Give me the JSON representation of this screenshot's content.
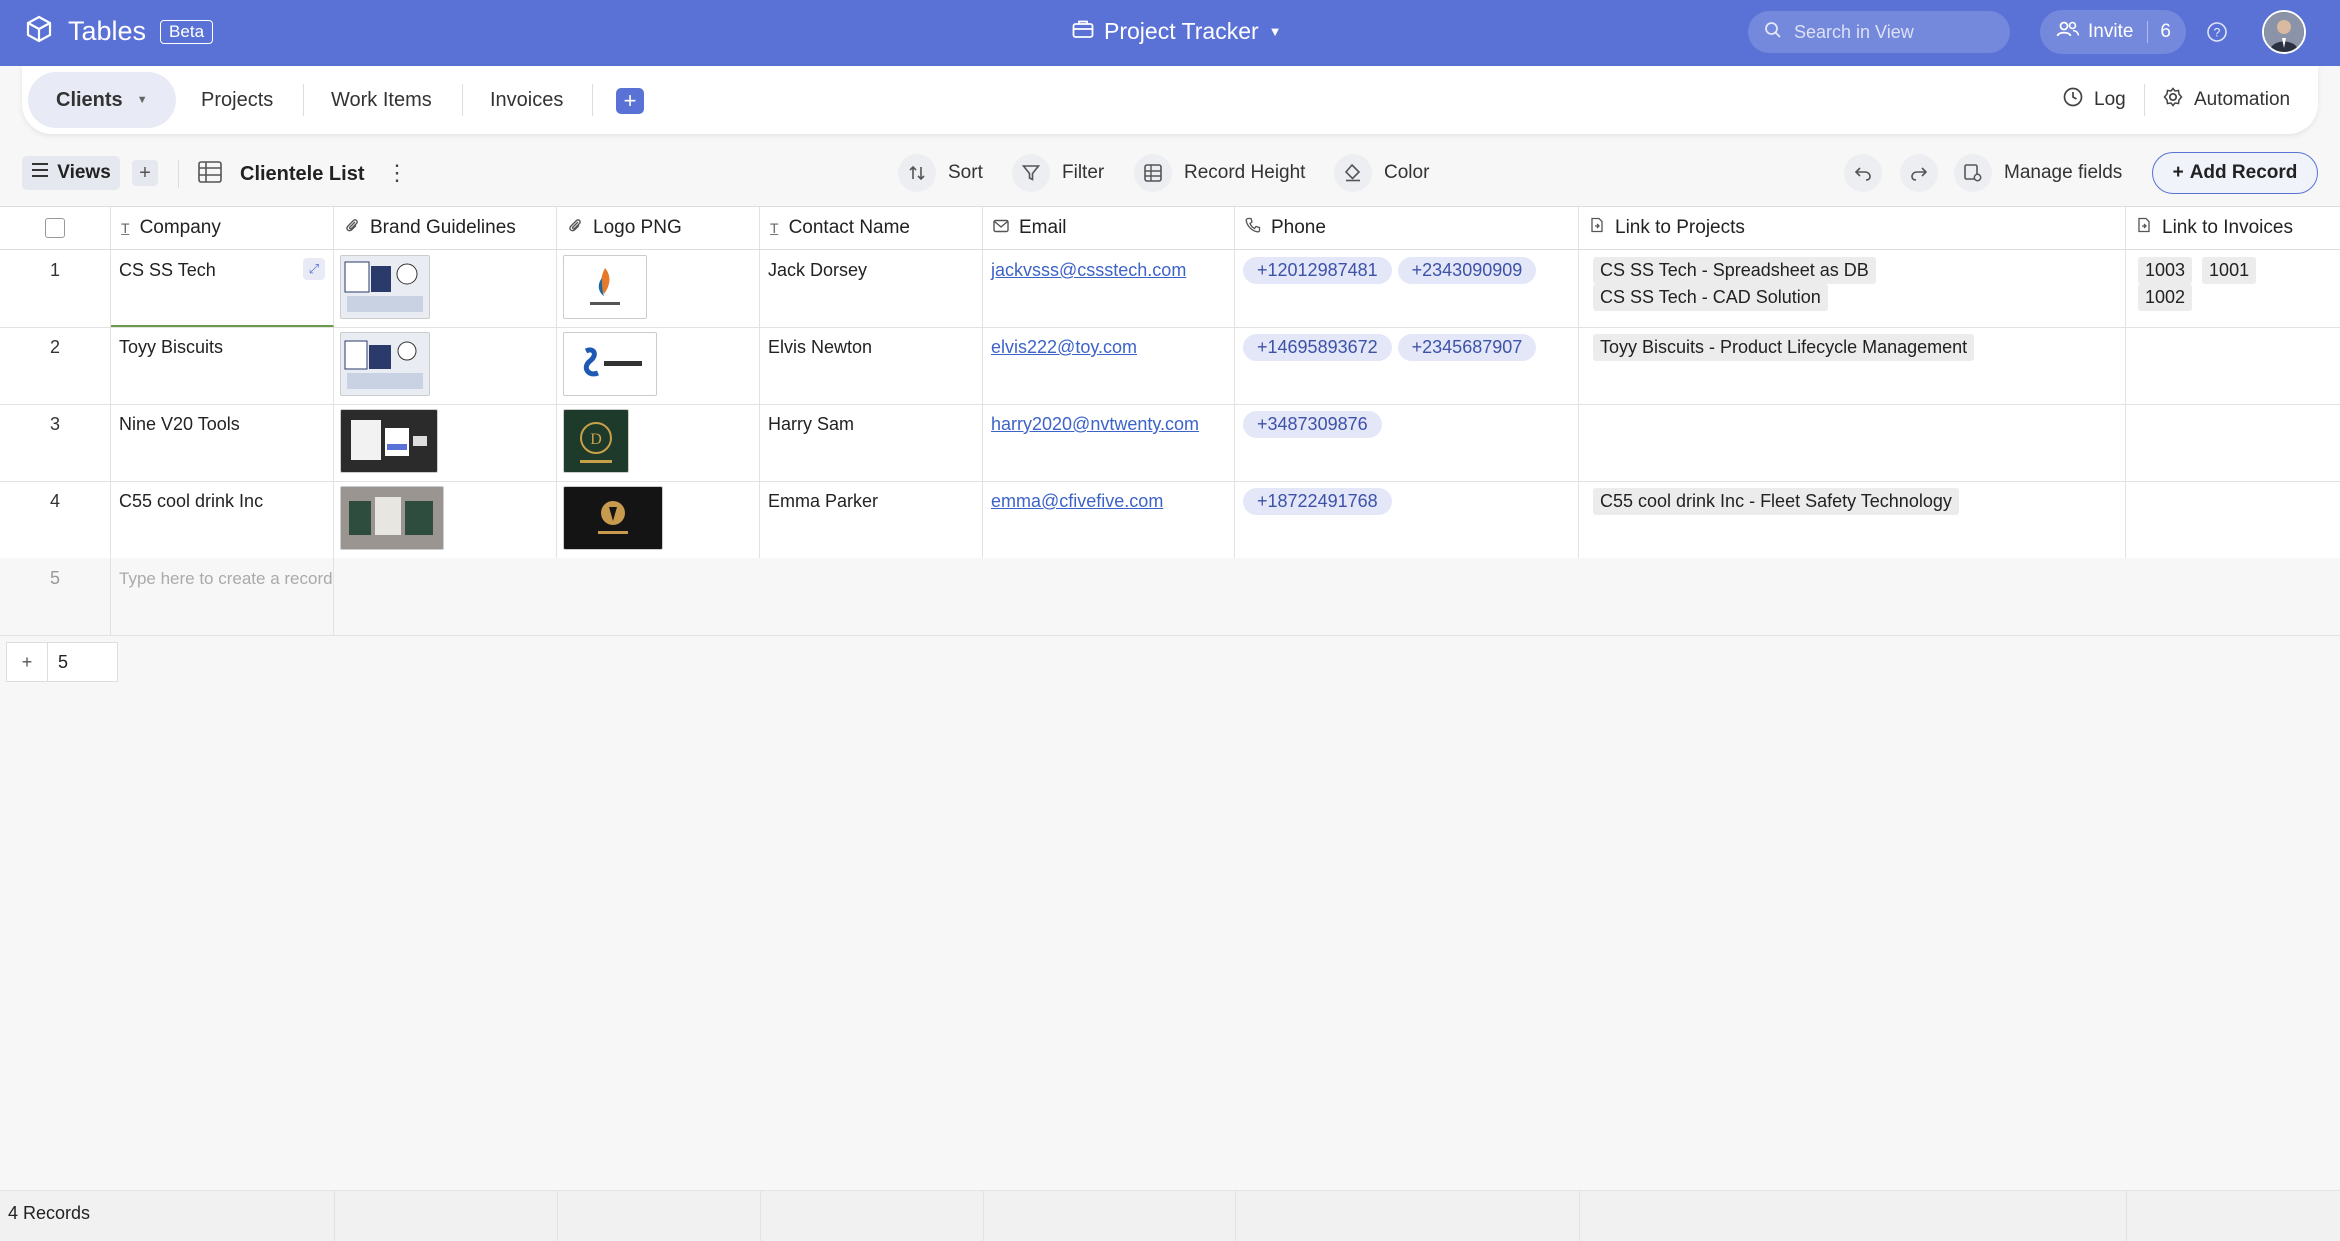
{
  "app": {
    "name": "Tables",
    "badge": "Beta"
  },
  "project": {
    "title": "Project Tracker"
  },
  "search": {
    "placeholder": "Search in View"
  },
  "invite": {
    "label": "Invite",
    "count": "6"
  },
  "tabs": [
    {
      "label": "Clients",
      "active": true
    },
    {
      "label": "Projects"
    },
    {
      "label": "Work Items"
    },
    {
      "label": "Invoices"
    }
  ],
  "tab_right": {
    "log": "Log",
    "automation": "Automation"
  },
  "toolbar": {
    "views": "Views",
    "view_name": "Clientele List",
    "sort": "Sort",
    "filter": "Filter",
    "record_height": "Record Height",
    "color": "Color",
    "manage_fields": "Manage fields",
    "add_record": "Add Record"
  },
  "columns": [
    "Company",
    "Brand Guidelines",
    "Logo PNG",
    "Contact Name",
    "Email",
    "Phone",
    "Link to Projects",
    "Link to Invoices"
  ],
  "rows": [
    {
      "num": "1",
      "company": "CS SS Tech",
      "contact": "Jack Dorsey",
      "email": "jackvsss@cssstech.com",
      "phones": [
        "+12012987481",
        "+2343090909"
      ],
      "projects": [
        "CS SS Tech - Spreadsheet as DB",
        "CS SS Tech - CAD Solution"
      ],
      "invoices": [
        "1003",
        "1001",
        "1002"
      ]
    },
    {
      "num": "2",
      "company": "Toyy Biscuits",
      "contact": "Elvis Newton",
      "email": "elvis222@toy.com",
      "phones": [
        "+14695893672",
        "+2345687907"
      ],
      "projects": [
        "Toyy Biscuits - Product Lifecycle Management"
      ],
      "invoices": []
    },
    {
      "num": "3",
      "company": "Nine V20 Tools",
      "contact": "Harry Sam",
      "email": "harry2020@nvtwenty.com",
      "phones": [
        "+3487309876"
      ],
      "projects": [],
      "invoices": []
    },
    {
      "num": "4",
      "company": "C55 cool drink Inc",
      "contact": "Emma Parker",
      "email": "emma@cfivefive.com",
      "phones": [
        "+18722491768"
      ],
      "projects": [
        "C55 cool drink Inc - Fleet Safety Technology"
      ],
      "invoices": []
    }
  ],
  "new_row": {
    "num": "5",
    "hint": "Type here to create a record"
  },
  "footer": {
    "row_count_input": "5",
    "records": "4 Records"
  },
  "colors": {
    "accent": "#5a72d6",
    "chip_bg": "#e3e7f7",
    "link": "#3d63c9"
  }
}
